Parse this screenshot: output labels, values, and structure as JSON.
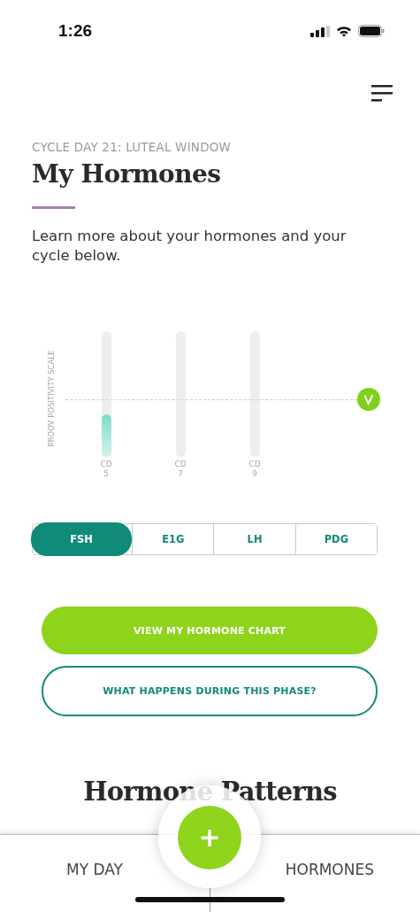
{
  "status_bar": {
    "time": "1:26"
  },
  "header": {
    "eyebrow": "CYCLE DAY 21: LUTEAL WINDOW",
    "title": "My Hormones",
    "intro": "Learn more about your hormones and your cycle below."
  },
  "chart": {
    "axis_label": "PROOV POSITIVITY SCALE",
    "bars": [
      {
        "label": "CD",
        "day": "5",
        "level": 0.34
      },
      {
        "label": "CD",
        "day": "7"
      },
      {
        "label": "CD",
        "day": "9"
      }
    ]
  },
  "segments": [
    {
      "label": "FSH",
      "selected": true
    },
    {
      "label": "E1G",
      "selected": false
    },
    {
      "label": "LH",
      "selected": false
    },
    {
      "label": "PDG",
      "selected": false
    }
  ],
  "buttons": [
    {
      "kind": "filled",
      "label": "VIEW MY HORMONE CHART"
    },
    {
      "kind": "outline",
      "label": "WHAT HAPPENS DURING THIS PHASE?"
    }
  ],
  "section_title": "Hormone Patterns",
  "tab_bar": {
    "items": [
      {
        "label": "MY DAY"
      },
      {
        "label": "HORMONES"
      }
    ],
    "add_label": "+"
  }
}
